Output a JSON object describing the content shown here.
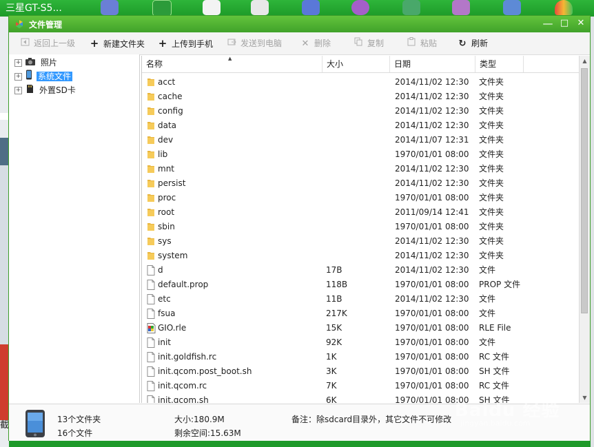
{
  "background_app": {
    "title": "三星GT-S5...",
    "bottom_left_text": "截"
  },
  "window": {
    "title": "文件管理",
    "controls": {
      "minimize": "—",
      "maximize": "□",
      "close": "✕"
    }
  },
  "toolbar": {
    "items": [
      {
        "label": "返回上一级",
        "icon": "back-arrow-icon",
        "enabled": false
      },
      {
        "label": "新建文件夹",
        "icon": "plus-icon",
        "enabled": true
      },
      {
        "label": "上传到手机",
        "icon": "plus-icon",
        "enabled": true
      },
      {
        "label": "发送到电脑",
        "icon": "send-icon",
        "enabled": false
      },
      {
        "label": "删除",
        "icon": "delete-x-icon",
        "enabled": false
      },
      {
        "label": "复制",
        "icon": "copy-icon",
        "enabled": false
      },
      {
        "label": "粘贴",
        "icon": "paste-icon",
        "enabled": false
      },
      {
        "label": "刷新",
        "icon": "refresh-icon",
        "enabled": true
      }
    ]
  },
  "tree": {
    "nodes": [
      {
        "label": "照片",
        "icon": "camera-icon",
        "selected": false
      },
      {
        "label": "系统文件",
        "icon": "phone-icon",
        "selected": true
      },
      {
        "label": "外置SD卡",
        "icon": "sd-card-icon",
        "selected": false
      }
    ]
  },
  "file_list": {
    "columns": {
      "name": "名称",
      "size": "大小",
      "date": "日期",
      "type": "类型"
    },
    "sort_column": "名称",
    "rows": [
      {
        "name": "acct",
        "size": "",
        "date": "2014/11/02 12:30",
        "type": "文件夹",
        "kind": "folder"
      },
      {
        "name": "cache",
        "size": "",
        "date": "2014/11/02 12:30",
        "type": "文件夹",
        "kind": "folder"
      },
      {
        "name": "config",
        "size": "",
        "date": "2014/11/02 12:30",
        "type": "文件夹",
        "kind": "folder"
      },
      {
        "name": "data",
        "size": "",
        "date": "2014/11/02 12:30",
        "type": "文件夹",
        "kind": "folder"
      },
      {
        "name": "dev",
        "size": "",
        "date": "2014/11/07 12:31",
        "type": "文件夹",
        "kind": "folder"
      },
      {
        "name": "lib",
        "size": "",
        "date": "1970/01/01 08:00",
        "type": "文件夹",
        "kind": "folder"
      },
      {
        "name": "mnt",
        "size": "",
        "date": "2014/11/02 12:30",
        "type": "文件夹",
        "kind": "folder"
      },
      {
        "name": "persist",
        "size": "",
        "date": "2014/11/02 12:30",
        "type": "文件夹",
        "kind": "folder"
      },
      {
        "name": "proc",
        "size": "",
        "date": "1970/01/01 08:00",
        "type": "文件夹",
        "kind": "folder"
      },
      {
        "name": "root",
        "size": "",
        "date": "2011/09/14 12:41",
        "type": "文件夹",
        "kind": "folder"
      },
      {
        "name": "sbin",
        "size": "",
        "date": "1970/01/01 08:00",
        "type": "文件夹",
        "kind": "folder"
      },
      {
        "name": "sys",
        "size": "",
        "date": "2014/11/02 12:30",
        "type": "文件夹",
        "kind": "folder"
      },
      {
        "name": "system",
        "size": "",
        "date": "2014/11/02 12:30",
        "type": "文件夹",
        "kind": "folder"
      },
      {
        "name": "d",
        "size": "17B",
        "date": "2014/11/02 12:30",
        "type": "文件",
        "kind": "file"
      },
      {
        "name": "default.prop",
        "size": "118B",
        "date": "1970/01/01 08:00",
        "type": "PROP 文件",
        "kind": "file"
      },
      {
        "name": "etc",
        "size": "11B",
        "date": "2014/11/02 12:30",
        "type": "文件",
        "kind": "file"
      },
      {
        "name": "fsua",
        "size": "217K",
        "date": "1970/01/01 08:00",
        "type": "文件",
        "kind": "file"
      },
      {
        "name": "GIO.rle",
        "size": "15K",
        "date": "1970/01/01 08:00",
        "type": "RLE File",
        "kind": "rle"
      },
      {
        "name": "init",
        "size": "92K",
        "date": "1970/01/01 08:00",
        "type": "文件",
        "kind": "file"
      },
      {
        "name": "init.goldfish.rc",
        "size": "1K",
        "date": "1970/01/01 08:00",
        "type": "RC 文件",
        "kind": "file"
      },
      {
        "name": "init.qcom.post_boot.sh",
        "size": "3K",
        "date": "1970/01/01 08:00",
        "type": "SH 文件",
        "kind": "file"
      },
      {
        "name": "init.qcom.rc",
        "size": "7K",
        "date": "1970/01/01 08:00",
        "type": "RC 文件",
        "kind": "file"
      },
      {
        "name": "init.qcom.sh",
        "size": "6K",
        "date": "1970/01/01 08:00",
        "type": "SH 文件",
        "kind": "file"
      }
    ]
  },
  "status": {
    "folders": "13个文件夹",
    "files": "16个文件",
    "size": "大小:180.9M",
    "free": "剩余空间:15.63M",
    "note": "备注：除sdcard目录外，其它文件不可修改"
  },
  "watermark": {
    "main": "Baidu 经验",
    "sub": "jingyan.baidu.com"
  },
  "colors": {
    "titlebar": "#4fb232",
    "selection": "#3399ff",
    "folder": "#f2c14e"
  }
}
